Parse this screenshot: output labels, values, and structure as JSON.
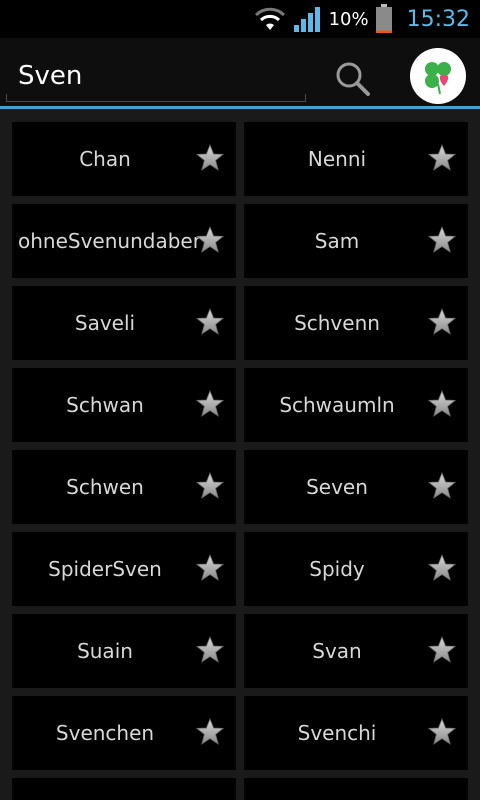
{
  "status_bar": {
    "battery_percent_label": "10%",
    "battery_level": 0.1,
    "time": "15:32",
    "icons": [
      "wifi-icon",
      "signal-icon",
      "battery-icon"
    ]
  },
  "search": {
    "value": "Sven",
    "button_icon": "search-icon"
  },
  "app_logo_icon": "clover-heart-logo",
  "colors": {
    "accent": "#3aa6d8",
    "clock": "#5fb9e8",
    "tile_bg": "#000000",
    "page_bg": "#1a1a1a",
    "star": "#a8a8a8"
  },
  "names": [
    {
      "label": "Chan"
    },
    {
      "label": "Nenni"
    },
    {
      "label": "ohneSvenundaber"
    },
    {
      "label": "Sam"
    },
    {
      "label": "Saveli"
    },
    {
      "label": "Schvenn"
    },
    {
      "label": "Schwan"
    },
    {
      "label": "Schwaumln"
    },
    {
      "label": "Schwen"
    },
    {
      "label": "Seven"
    },
    {
      "label": "SpiderSven"
    },
    {
      "label": "Spidy"
    },
    {
      "label": "Suain"
    },
    {
      "label": "Svan"
    },
    {
      "label": "Svenchen"
    },
    {
      "label": "Svenchi"
    }
  ]
}
